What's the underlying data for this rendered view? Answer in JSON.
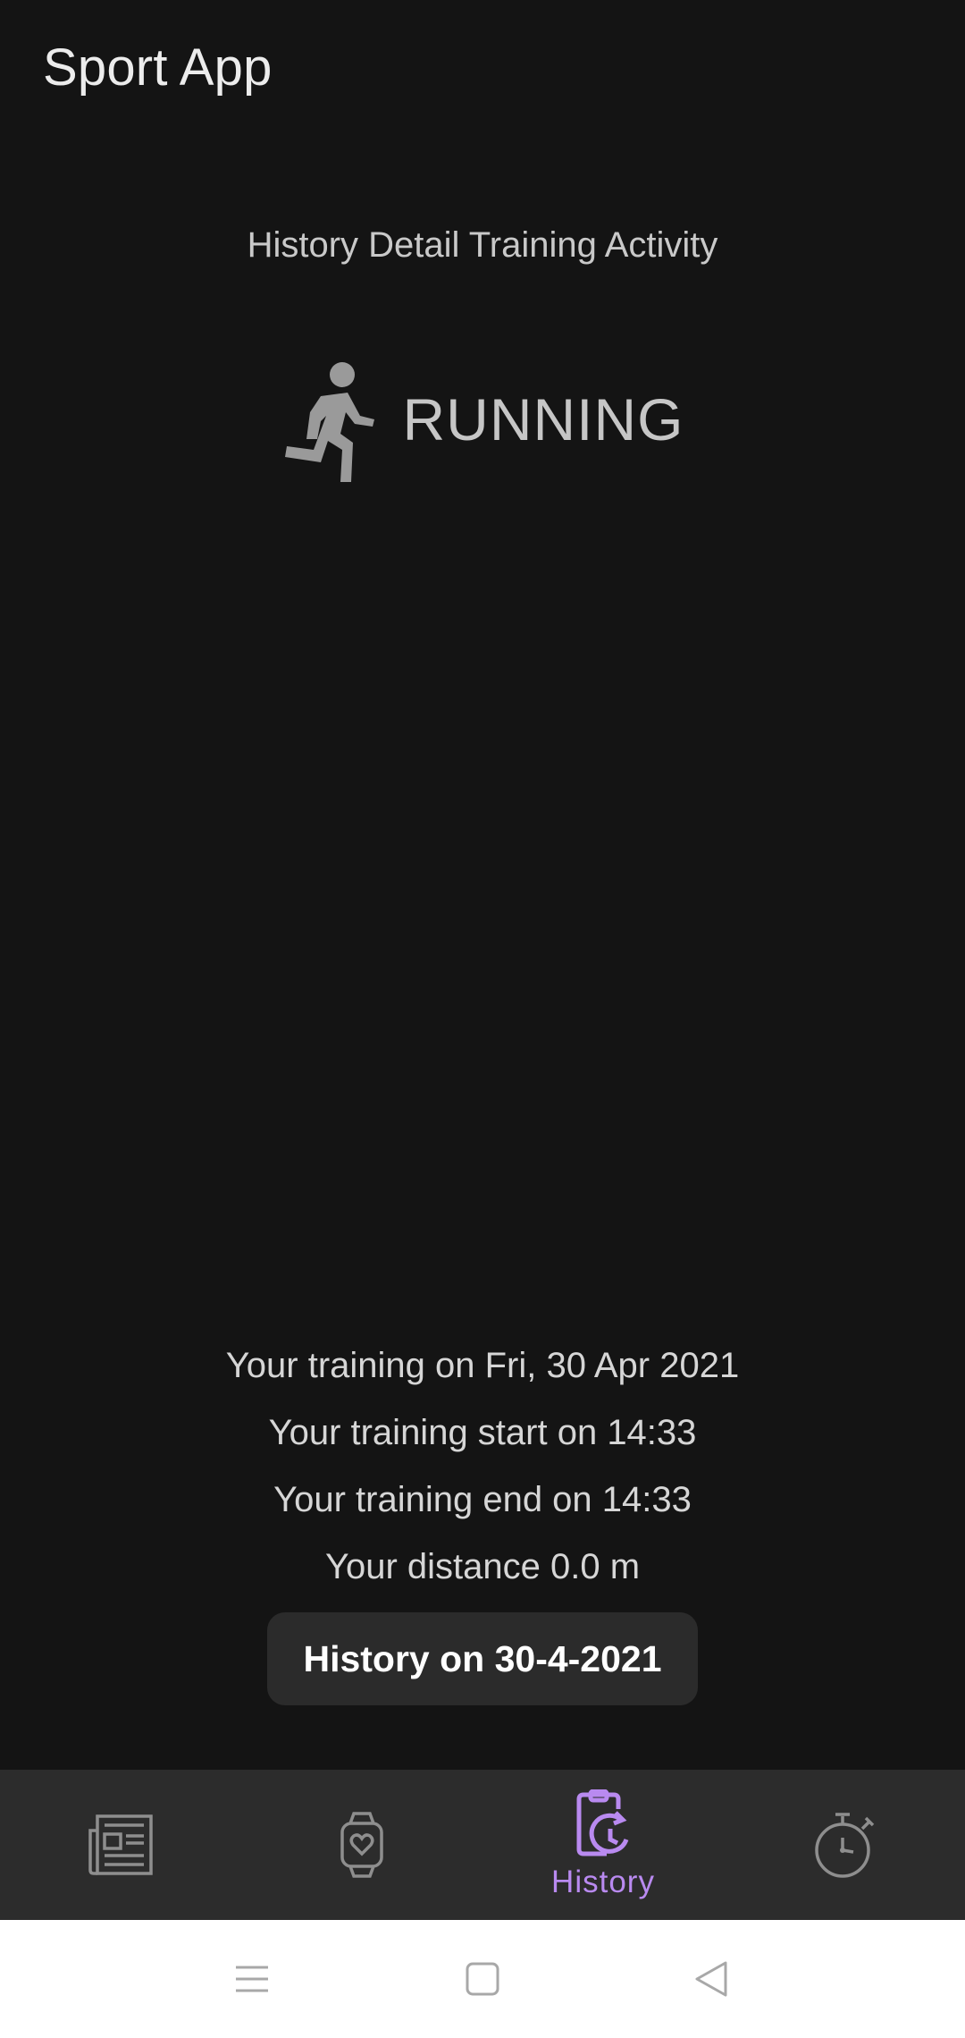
{
  "app": {
    "title": "Sport App"
  },
  "detail": {
    "heading": "History Detail Training Activity",
    "activity_icon": "running-person-icon",
    "activity_name": "RUNNING",
    "training_date": "Your training on Fri, 30 Apr 2021",
    "training_start": "Your training start on 14:33",
    "training_end": "Your training end on 14:33",
    "distance": "Your distance 0.0 m",
    "history_button_label": "History on 30-4-2021"
  },
  "bottom_nav": {
    "items": [
      {
        "icon": "newspaper-icon",
        "label": "",
        "active": false
      },
      {
        "icon": "smartwatch-heart-icon",
        "label": "",
        "active": false
      },
      {
        "icon": "history-clipboard-icon",
        "label": "History",
        "active": true
      },
      {
        "icon": "stopwatch-icon",
        "label": "",
        "active": false
      }
    ]
  },
  "system_nav": {
    "items": [
      "menu-icon",
      "home-square-icon",
      "back-triangle-icon"
    ]
  },
  "colors": {
    "background": "#141414",
    "nav_background": "#2c2c2c",
    "accent": "#b98af0",
    "icon_inactive": "#8e8e8e",
    "button_background": "#2b2b2b"
  }
}
